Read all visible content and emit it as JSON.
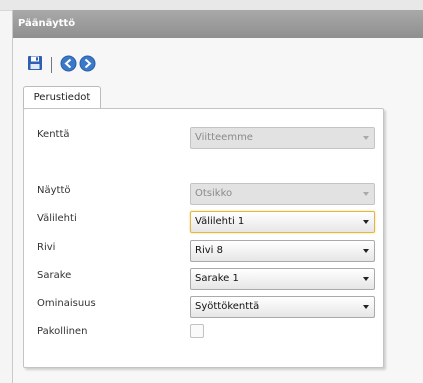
{
  "window": {
    "title": "Päänäyttö"
  },
  "toolbar": {
    "items": [
      {
        "name": "save-icon"
      },
      {
        "name": "back-icon"
      },
      {
        "name": "forward-icon"
      }
    ]
  },
  "tabs": [
    {
      "label": "Perustiedot",
      "active": true
    }
  ],
  "form": {
    "kentta": {
      "label": "Kenttä",
      "value": "Viitteemme",
      "disabled": true
    },
    "naytto": {
      "label": "Näyttö",
      "value": "Otsikko",
      "disabled": true
    },
    "valilehti": {
      "label": "Välilehti",
      "value": "Välilehti 1"
    },
    "rivi": {
      "label": "Rivi",
      "value": "Rivi 8"
    },
    "sarake": {
      "label": "Sarake",
      "value": "Sarake 1"
    },
    "ominaisuus": {
      "label": "Ominaisuus",
      "value": "Syöttökenttä"
    },
    "pakollinen": {
      "label": "Pakollinen",
      "checked": false
    }
  },
  "colors": {
    "titlebar": "#999999",
    "icon_blue": "#3a78c9",
    "focus": "#e0b84a"
  }
}
